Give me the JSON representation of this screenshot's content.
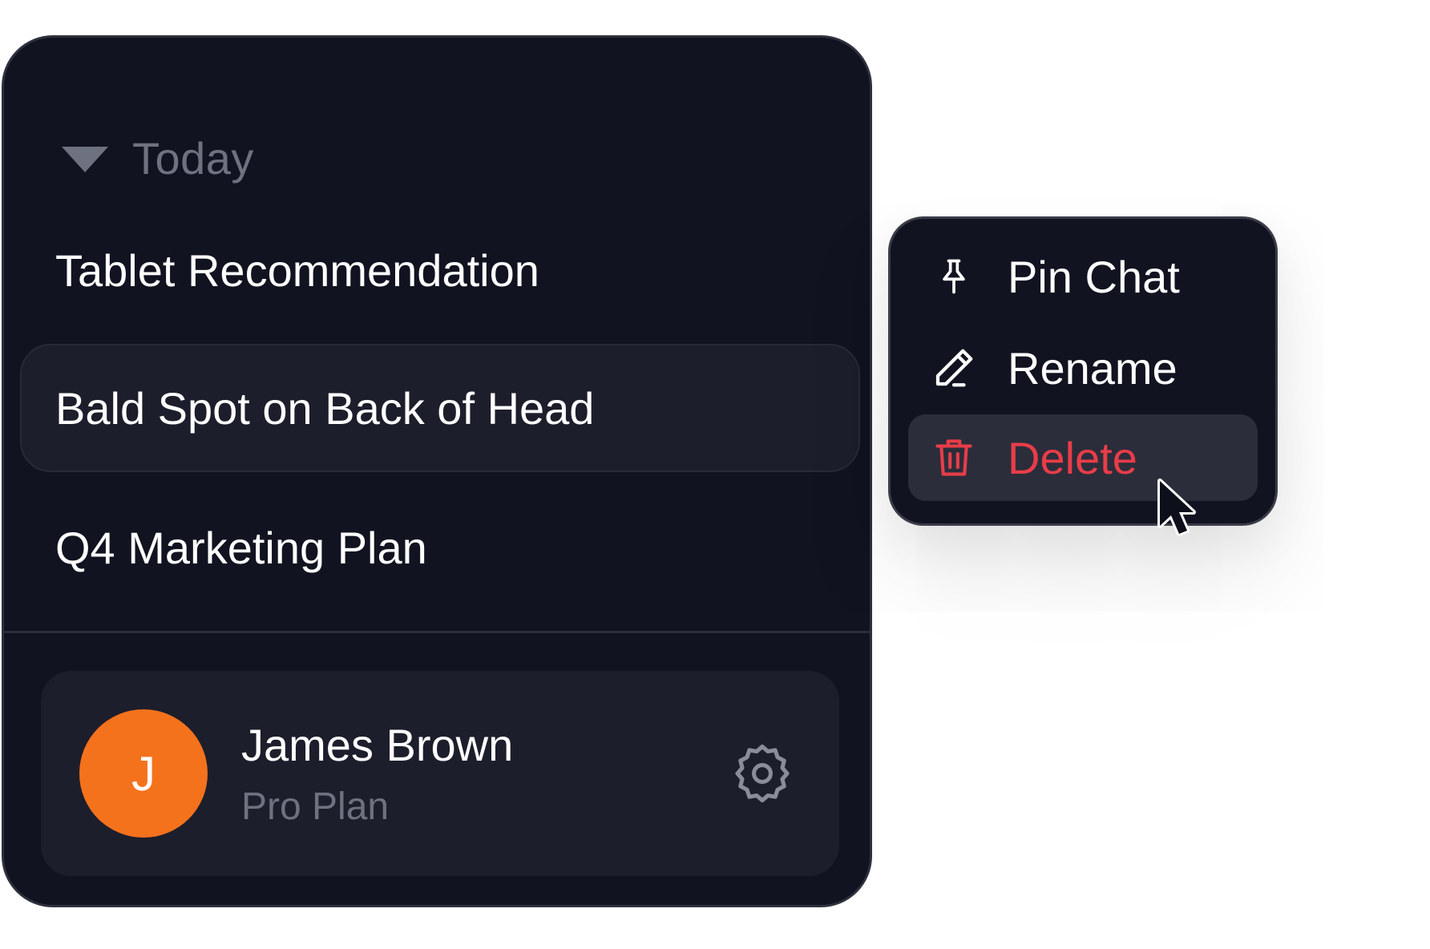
{
  "sidebar": {
    "section_label": "Today",
    "chats": [
      {
        "label": "Tablet Recommendation",
        "active": false
      },
      {
        "label": "Bald Spot on Back of Head",
        "active": true
      },
      {
        "label": "Q4 Marketing Plan",
        "active": false
      }
    ],
    "user": {
      "initial": "J",
      "name": "James Brown",
      "plan": "Pro Plan",
      "avatar_color": "#f5721d"
    }
  },
  "context_menu": {
    "items": [
      {
        "label": "Pin Chat",
        "icon": "pin-icon"
      },
      {
        "label": "Rename",
        "icon": "pencil-icon"
      },
      {
        "label": "Delete",
        "icon": "trash-icon",
        "color": "#e83d48",
        "hovered": true
      }
    ]
  },
  "colors": {
    "panel_bg": "#111320",
    "active_bg": "#1d1e2b",
    "muted_text": "#6e717f",
    "danger": "#e83d48"
  }
}
